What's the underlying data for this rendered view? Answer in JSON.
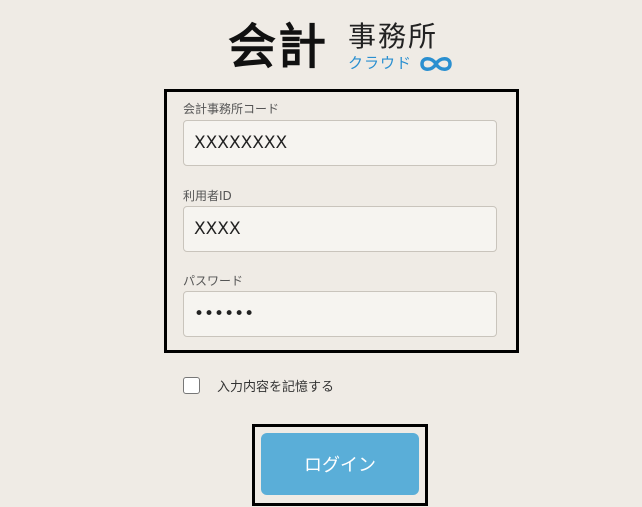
{
  "logo": {
    "main": "会計",
    "sub": "事務所",
    "cloud": "クラウド",
    "infinity_icon": "infinity-icon",
    "accent_color": "#2a8fd0"
  },
  "form": {
    "office_code_label": "会計事務所コード",
    "office_code_value": "XXXXXXXX",
    "user_id_label": "利用者ID",
    "user_id_value": "XXXX",
    "password_label": "パスワード",
    "password_value": "••••••"
  },
  "remember": {
    "label": "入力内容を記憶する",
    "checked": false
  },
  "login": {
    "label": "ログイン",
    "color": "#5aaed8"
  }
}
